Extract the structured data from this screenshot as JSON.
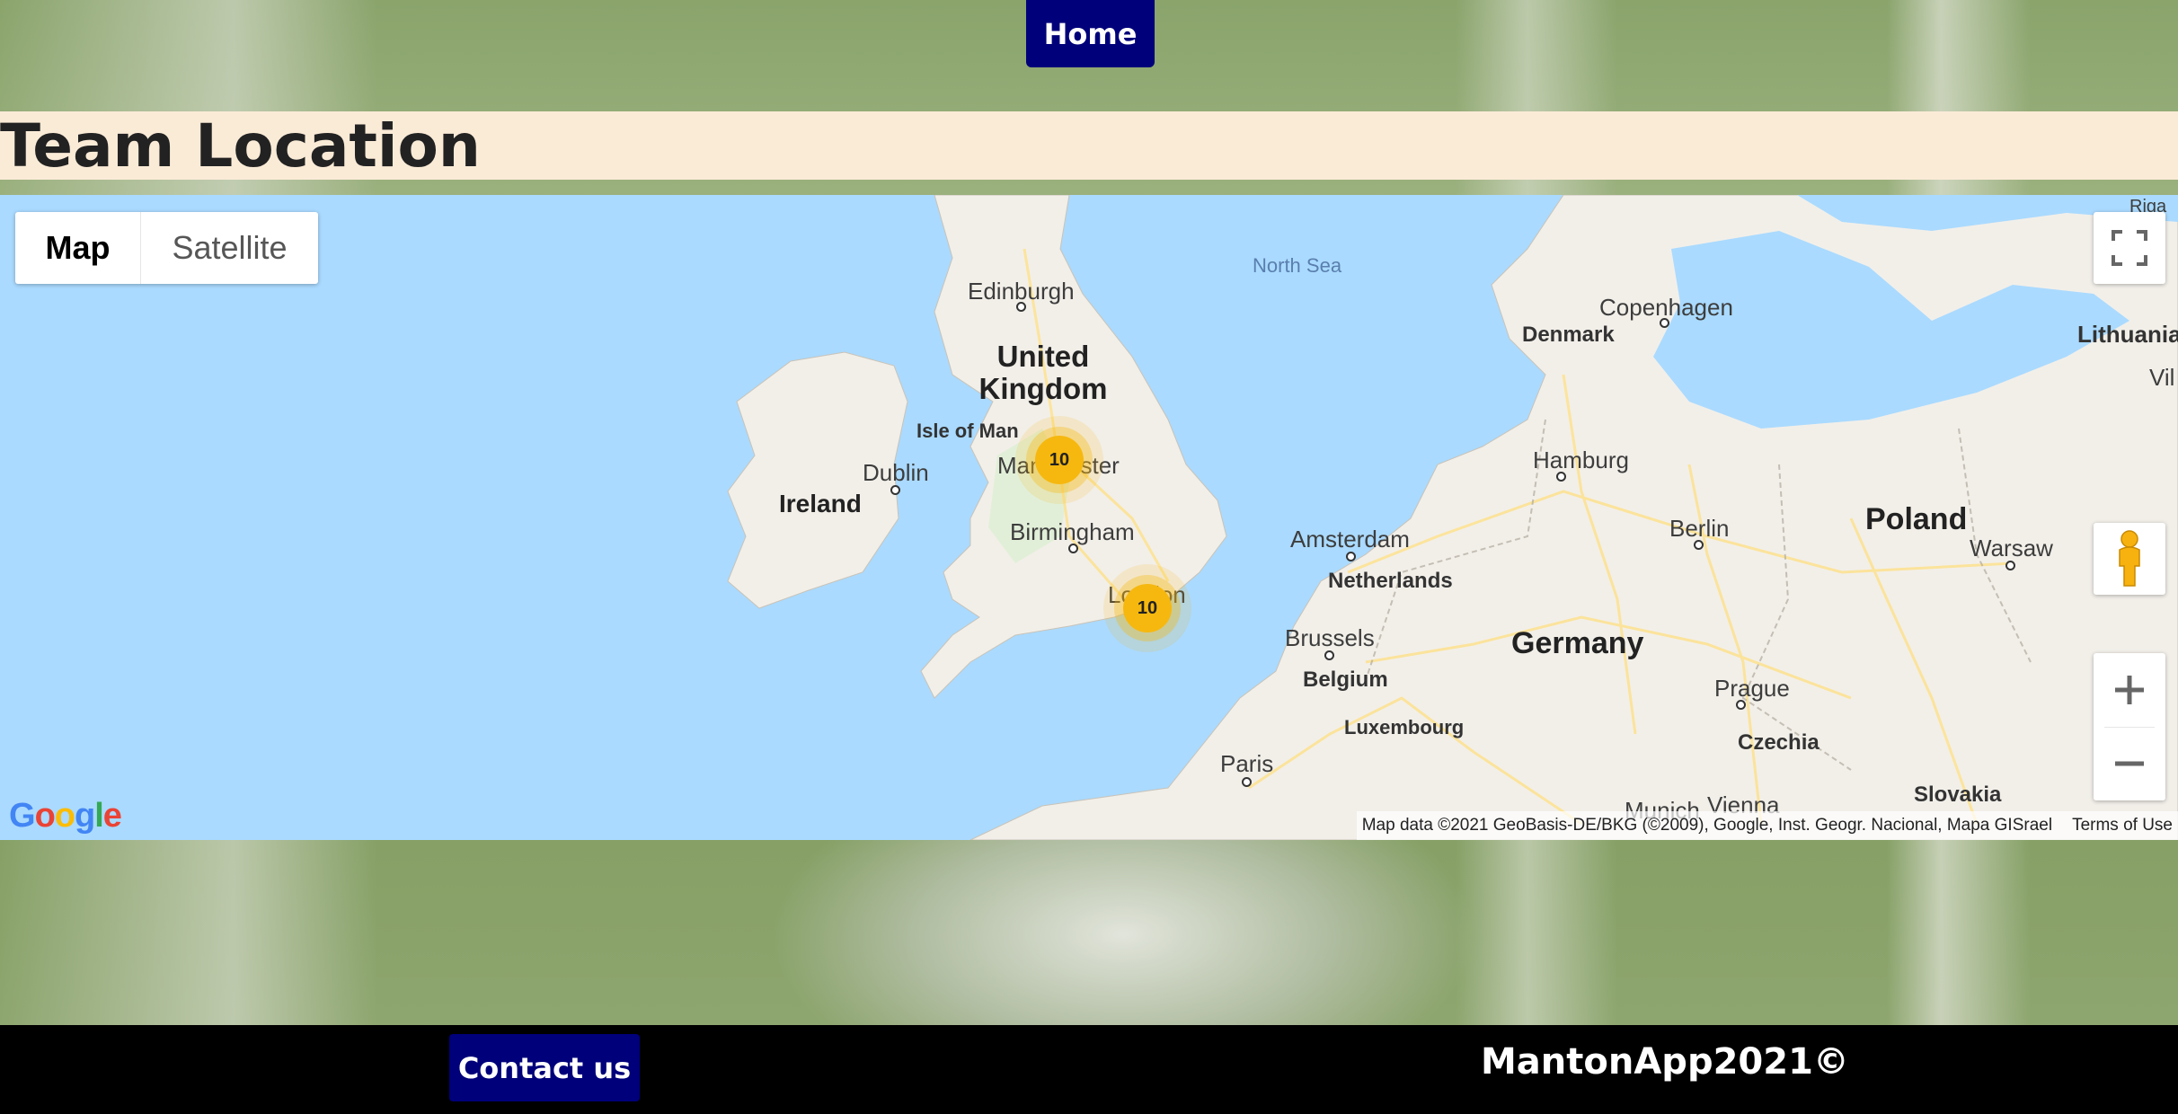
{
  "nav": {
    "home_label": "Home"
  },
  "page": {
    "title": "Team Location"
  },
  "map": {
    "type_control": {
      "map_label": "Map",
      "satellite_label": "Satellite",
      "selected": "Map"
    },
    "labels": {
      "north_sea": "North Sea",
      "edinburgh": "Edinburgh",
      "copenhagen": "Copenhagen",
      "denmark": "Denmark",
      "lithuania": "Lithuania",
      "vilnius_partial": "Vil",
      "riga_partial": "Riga",
      "united_kingdom": "United Kingdom",
      "isle_of_man": "Isle of Man",
      "manchester": "Manchester",
      "dublin": "Dublin",
      "ireland": "Ireland",
      "hamburg": "Hamburg",
      "birmingham": "Birmingham",
      "amsterdam": "Amsterdam",
      "netherlands": "Netherlands",
      "berlin": "Berlin",
      "poland": "Poland",
      "warsaw": "Warsaw",
      "london": "London",
      "brussels": "Brussels",
      "belgium": "Belgium",
      "germany": "Germany",
      "prague": "Prague",
      "luxembourg": "Luxembourg",
      "czechia": "Czechia",
      "paris": "Paris",
      "slovakia": "Slovakia",
      "munich": "Munich",
      "vienna": "Vienna"
    },
    "clusters": [
      {
        "location": "Manchester",
        "count": "10"
      },
      {
        "location": "London",
        "count": "10"
      }
    ],
    "google_logo": "Google",
    "attribution": "Map data ©2021 GeoBasis-DE/BKG (©2009), Google, Inst. Geogr. Nacional, Mapa GISrael",
    "terms": "Terms of Use",
    "icons": [
      "fullscreen-icon",
      "pegman-icon",
      "zoom-in-icon",
      "zoom-out-icon"
    ],
    "colors": {
      "water": "#aadaff",
      "land": "#f2efe9",
      "cluster": "#f6b80f",
      "roads": "#fde293"
    }
  },
  "footer": {
    "contact_label": "Contact us",
    "copyright": "MantonApp2021©"
  },
  "colors": {
    "button_bg": "#00007a",
    "title_bar_bg": "#faebd7",
    "footer_bg": "#000000"
  }
}
